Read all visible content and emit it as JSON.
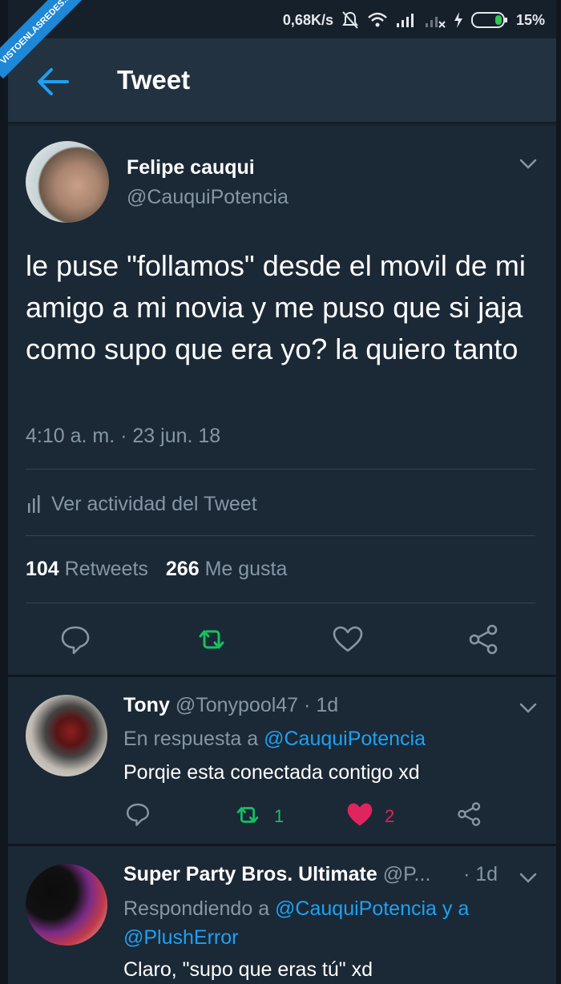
{
  "watermark": "VISTOENLASREDES.com",
  "status_bar": {
    "left": "",
    "speed": "0,68K/s",
    "battery": "15%"
  },
  "header": {
    "title": "Tweet"
  },
  "tweet": {
    "author_name": "Felipe cauqui",
    "author_handle": "@CauquiPotencia",
    "text": "le puse \"follamos\" desde el movil de mi amigo a mi novia y me puso que si jaja como supo que era yo? la quiero tanto",
    "timestamp": "4:10 a. m. · 23 jun. 18",
    "activity_label": "Ver actividad del Tweet",
    "retweets_count": "104",
    "retweets_label": "Retweets",
    "likes_count": "266",
    "likes_label": "Me gusta"
  },
  "replies": [
    {
      "name": "Tony",
      "handle": "@Tonypool47",
      "time": "· 1d",
      "reply_prefix": "En respuesta a",
      "reply_to": "@CauquiPotencia",
      "text": "Porqie esta conectada contigo xd",
      "retweets": "1",
      "likes": "2"
    },
    {
      "name": "Super Party Bros. Ultimate",
      "handle": "@P...",
      "time": "· 1d",
      "reply_prefix": "Respondiendo a",
      "reply_to": "@CauquiPotencia y a",
      "reply_to_2": "@PlushError",
      "text": "Claro, \"supo que eras tú\" xd"
    }
  ],
  "colors": {
    "background": "#1b2836",
    "header": "#233241",
    "accent": "#1da1f2",
    "retweet_green": "#17bf63",
    "like_pink": "#e0245e",
    "muted": "#8596a6"
  }
}
